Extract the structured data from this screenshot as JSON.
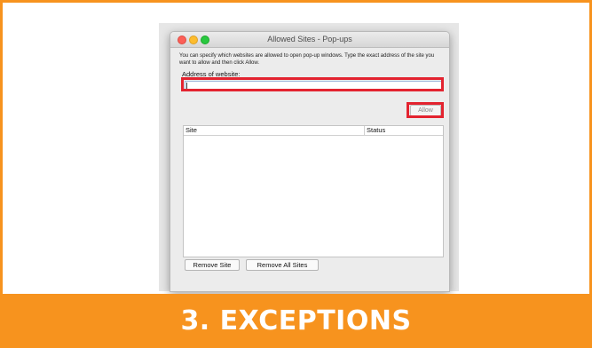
{
  "window": {
    "title": "Allowed Sites - Pop-ups",
    "description": "You can specify which websites are allowed to open pop-up windows. Type the exact address of the site you want to allow and then click Allow."
  },
  "address": {
    "label": "Address of website:",
    "value": "",
    "placeholder": ""
  },
  "buttons": {
    "allow": "Allow",
    "remove_site": "Remove Site",
    "remove_all_sites": "Remove All Sites"
  },
  "table": {
    "columns": [
      "Site",
      "Status"
    ],
    "rows": []
  },
  "banner": {
    "text": "3. EXCEPTIONS"
  },
  "colors": {
    "accent_orange": "#f7931e",
    "highlight_red": "#e3232f"
  }
}
